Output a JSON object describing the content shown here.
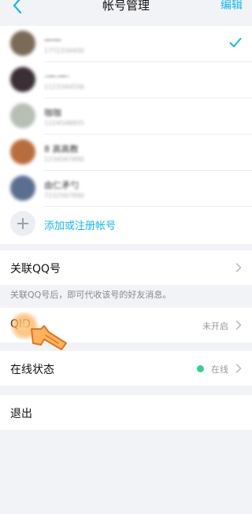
{
  "nav": {
    "title": "帐号管理",
    "edit_label": "编辑"
  },
  "accounts": [
    {
      "name": "一一",
      "sub": "1772334450",
      "color": "#7b6a55",
      "selected": true
    },
    {
      "name": "·一·一·",
      "sub": "1123344556",
      "color": "#3a2f35",
      "selected": false
    },
    {
      "name": "咖咖",
      "sub": "1224548855",
      "color": "#b7bfb5",
      "selected": false
    },
    {
      "name": "8 高高教",
      "sub": "1234567890",
      "color": "#b96d3c",
      "selected": false
    },
    {
      "name": "由仁矛勺",
      "sub": "7232567890",
      "color": "#5a6f90",
      "selected": false
    }
  ],
  "add_account_label": "添加或注册帐号",
  "link_qq": {
    "label": "关联QQ号",
    "note": "关联QQ号后，即可代收该号的好友消息。"
  },
  "qid": {
    "label": "QID",
    "value": "未开启"
  },
  "online_status": {
    "label": "在线状态",
    "value": "在线",
    "dot_color": "#2fd48a"
  },
  "logout_label": "退出",
  "colors": {
    "accent": "#12b7f5",
    "background": "#f2f3f7"
  }
}
